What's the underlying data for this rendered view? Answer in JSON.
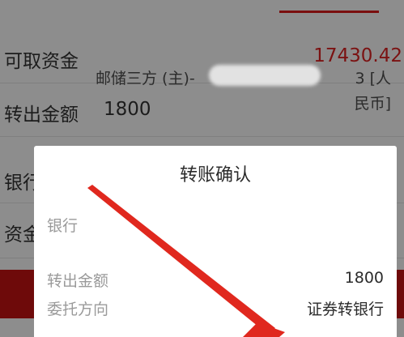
{
  "form": {
    "available_funds_label": "可取资金",
    "available_funds_value": "17430.42",
    "transfer_amount_label": "转出金额",
    "transfer_amount_value": "1800",
    "bank_label_partial": "银行",
    "funds_label_partial": "资金"
  },
  "dialog": {
    "title": "转账确认",
    "bank_label": "银行",
    "bank_value_line1": "邮储三方 (主)-",
    "bank_value_tail": "3 [人",
    "bank_value_line2": "民币]",
    "amount_label": "转出金额",
    "amount_value": "1800",
    "direction_label": "委托方向",
    "direction_value": "证券转银行"
  },
  "colors": {
    "accent_red": "#7b1212",
    "arrow_red": "#e0281e",
    "dim_background": "#8d8d8d"
  }
}
